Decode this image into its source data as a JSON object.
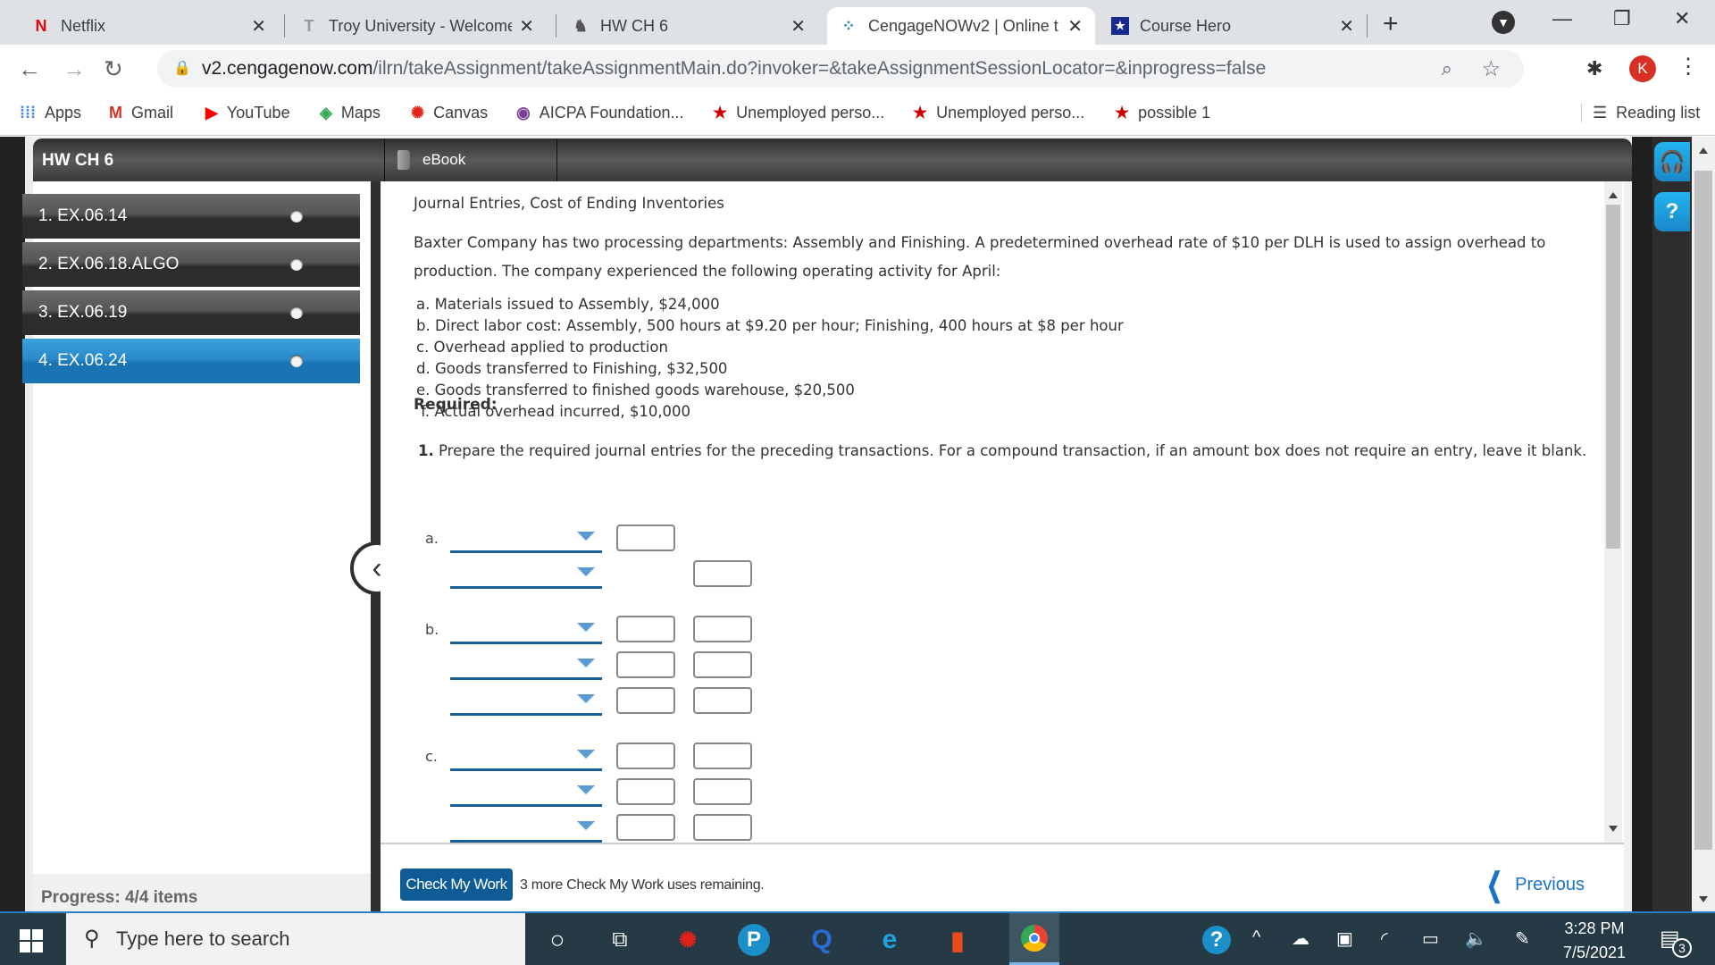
{
  "browser": {
    "tabs": [
      {
        "title": "Netflix",
        "icon": "netflix-icon",
        "active": false
      },
      {
        "title": "Troy University - Welcome",
        "icon": "troy-icon",
        "active": false
      },
      {
        "title": "HW CH 6",
        "icon": "spartan-icon",
        "active": false
      },
      {
        "title": "CengageNOWv2 | Online t",
        "icon": "cengage-icon",
        "active": true
      },
      {
        "title": "Course Hero",
        "icon": "coursehero-icon",
        "active": false
      }
    ],
    "url_host": "v2.cengagenow.com",
    "url_path": "/ilrn/takeAssignment/takeAssignmentMain.do?invoker=&takeAssignmentSessionLocator=&inprogress=false",
    "profile_initial": "K",
    "bookmarks": [
      {
        "label": "Apps",
        "icon": "apps-grid-icon"
      },
      {
        "label": "Gmail",
        "icon": "gmail-icon"
      },
      {
        "label": "YouTube",
        "icon": "youtube-icon"
      },
      {
        "label": "Maps",
        "icon": "maps-icon"
      },
      {
        "label": "Canvas",
        "icon": "canvas-icon"
      },
      {
        "label": "AICPA Foundation...",
        "icon": "aicpa-icon"
      },
      {
        "label": "Unemployed perso...",
        "icon": "star-flag-icon"
      },
      {
        "label": "Unemployed perso...",
        "icon": "star-flag-icon"
      },
      {
        "label": "possible 1",
        "icon": "star-flag-icon"
      }
    ],
    "reading_list": "Reading list"
  },
  "assignment": {
    "title": "HW CH 6",
    "ebook_label": "eBook",
    "questions": [
      {
        "label": "1. EX.06.14",
        "active": false
      },
      {
        "label": "2. EX.06.18.ALGO",
        "active": false
      },
      {
        "label": "3. EX.06.19",
        "active": false
      },
      {
        "label": "4. EX.06.24",
        "active": true
      }
    ],
    "progress": "Progress:  4/4 items"
  },
  "problem": {
    "title": "Journal Entries, Cost of Ending Inventories",
    "intro": "Baxter Company has two processing departments: Assembly and Finishing. A predetermined overhead rate of $10 per DLH is used to assign overhead to production. The company experienced the following operating activity for April:",
    "items": [
      "a. Materials issued to Assembly, $24,000",
      "b. Direct labor cost: Assembly, 500 hours at $9.20 per hour; Finishing, 400 hours at $8 per hour",
      "c. Overhead applied to production",
      "d. Goods transferred to Finishing, $32,500",
      "e. Goods transferred to finished goods warehouse, $20,500",
      " f. Actual overhead incurred, $10,000"
    ],
    "required_label": "Required:",
    "instruction_num": "1.",
    "instruction": " Prepare the required journal entries for the preceding transactions. For a compound transaction, if an amount box does not require an entry, leave it blank.",
    "entry_labels": {
      "a": "a.",
      "b": "b.",
      "c": "c."
    },
    "entries": {
      "debit_value": "",
      "credit_value": "",
      "account_value": ""
    }
  },
  "footer": {
    "check_button": "Check My Work",
    "remaining": "3 more Check My Work uses remaining.",
    "previous": "Previous"
  },
  "taskbar": {
    "search_placeholder": "Type here to search",
    "time": "3:28 PM",
    "date": "7/5/2021",
    "notifications": "3"
  }
}
